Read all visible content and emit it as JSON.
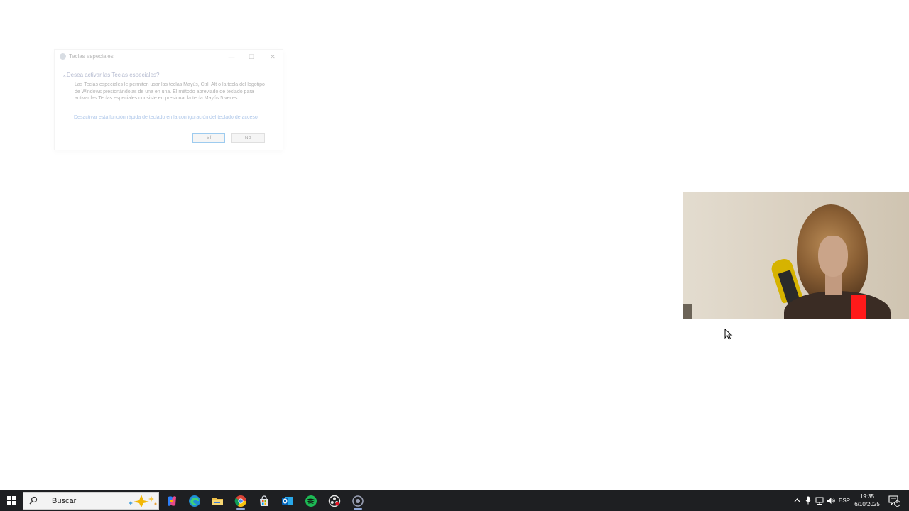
{
  "dialog": {
    "title": "Teclas especiales",
    "question": "¿Desea activar las Teclas especiales?",
    "body": "Las Teclas especiales le permiten usar las teclas Mayús, Ctrl, Alt o la tecla del logotipo de Windows presionándolas de una en una. El método abreviado de teclado para activar las Teclas especiales consiste en presionar la tecla Mayús 5 veces.",
    "link": "Desactivar esta función rápida de teclado en la configuración del teclado de acceso",
    "yes_label": "Sí",
    "no_label": "No",
    "min_glyph": "—",
    "max_glyph": "☐",
    "close_glyph": "✕"
  },
  "taskbar": {
    "search_placeholder": "Buscar",
    "apps": [
      {
        "icon": "copilot-icon"
      },
      {
        "icon": "edge-icon"
      },
      {
        "icon": "file-explorer-icon"
      },
      {
        "icon": "chrome-icon"
      },
      {
        "icon": "microsoft-store-icon"
      },
      {
        "icon": "outlook-icon"
      },
      {
        "icon": "spotify-icon"
      },
      {
        "icon": "obs-icon"
      },
      {
        "icon": "active-app-icon"
      }
    ],
    "language": "ESP",
    "time": "19:35",
    "date": "6/10/2025",
    "notification_count": "5"
  },
  "colors": {
    "taskbar_bg": "#1e1f22",
    "accent": "#0078d7",
    "spotify": "#1db954"
  }
}
